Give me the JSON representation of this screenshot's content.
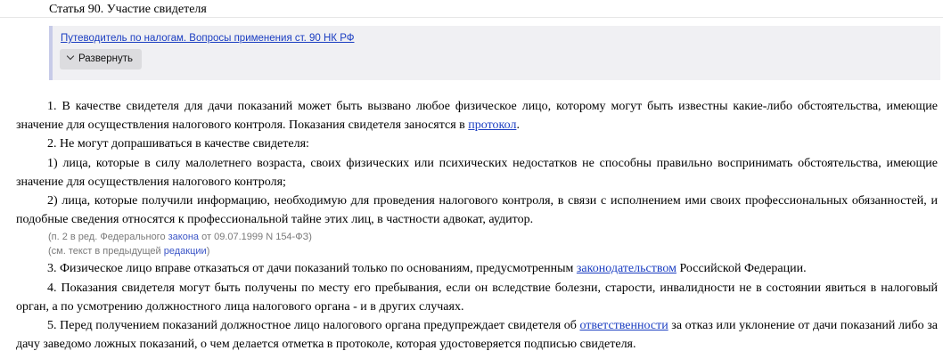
{
  "article": {
    "title": "Статья 90. Участие свидетеля"
  },
  "guide": {
    "link": "Путеводитель по налогам. Вопросы применения ст. 90 НК РФ",
    "expand_label": "Развернуть"
  },
  "paragraphs": {
    "p1": {
      "text": "1. В качестве свидетеля для дачи показаний может быть вызвано любое физическое лицо, которому могут быть известны какие-либо обстоятельства, имеющие значение для осуществления налогового контроля. Показания свидетеля заносятся в ",
      "link": "протокол",
      "after": "."
    },
    "p2": "2. Не могут допрашиваться в качестве свидетеля:",
    "p2_1": "1) лица, которые в силу малолетнего возраста, своих физических или психических недостатков не способны правильно воспринимать обстоятельства, имеющие значение для осуществления налогового контроля;",
    "p2_2": "2) лица, которые получили информацию, необходимую для проведения налогового контроля, в связи с исполнением ими своих профессиональных обязанностей, и подобные сведения относятся к профессиональной тайне этих лиц, в частности адвокат, аудитор.",
    "note1": {
      "before": "(п. 2 в ред. Федерального ",
      "link": "закона",
      "after": " от 09.07.1999 N 154-ФЗ)"
    },
    "note2": {
      "before": "(см. текст в предыдущей ",
      "link": "редакции",
      "after": ")"
    },
    "p3": {
      "text": "3. Физическое лицо вправе отказаться от дачи показаний только по основаниям, предусмотренным ",
      "link": "законодательством",
      "after": " Российской Федерации."
    },
    "p4": "4. Показания свидетеля могут быть получены по месту его пребывания, если он вследствие болезни, старости, инвалидности не в состоянии явиться в налоговый орган, а по усмотрению должностного лица налогового органа - и в других случаях.",
    "p5": {
      "text": "5. Перед получением показаний должностное лицо налогового органа предупреждает свидетеля об ",
      "link": "ответственности",
      "after": " за отказ или уклонение от дачи показаний либо за дачу заведомо ложных показаний, о чем делается отметка в протоколе, которая удостоверяется подписью свидетеля."
    }
  }
}
